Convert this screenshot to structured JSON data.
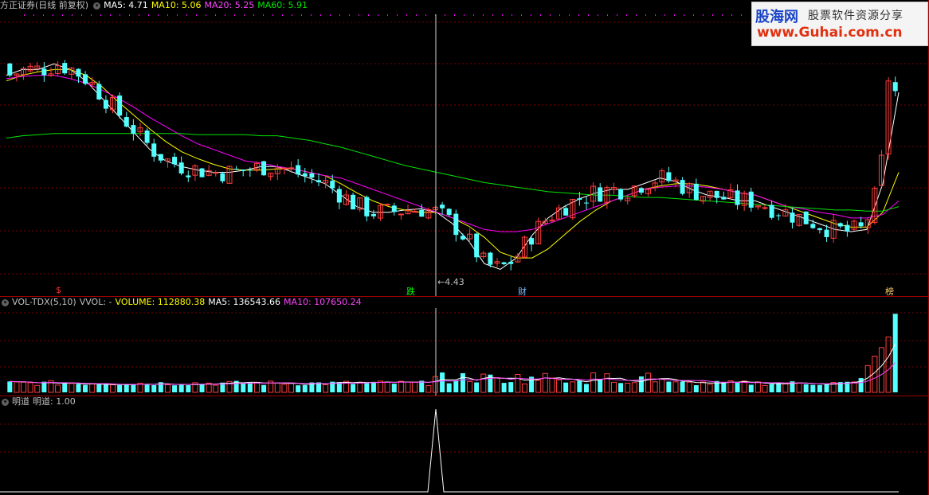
{
  "header": {
    "title": "方正证券(日线 前复权)",
    "ma5": "MA5: 4.71",
    "ma10": "MA10: 5.06",
    "ma20": "MA20: 5.25",
    "ma60": "MA60: 5.91"
  },
  "vol_header": {
    "name": "VOL-TDX(5,10)",
    "vvol": "VVOL: -",
    "volume": "VOLUME: 112880.38",
    "ma5": "MA5: 136543.66",
    "ma10": "MA10: 107650.24"
  },
  "ind_header": {
    "name": "明道",
    "value": "明道: 1.00"
  },
  "watermark": {
    "line1": "股海网",
    "line2": "股票软件资源分享",
    "line3": "www.Guhai.com.cn"
  },
  "markers": {
    "m1": "$",
    "m2": "跌",
    "m3": "财",
    "m4": "榜",
    "low_label": "←4.43"
  },
  "colors": {
    "up": "#ff3c3c",
    "down": "#54ffff",
    "ma5": "#ffffff",
    "ma10": "#ffff00",
    "ma20": "#ff00ff",
    "ma60": "#00e600"
  },
  "chart_data": [
    {
      "type": "candlestick",
      "title": "方正证券(日线 前复权)",
      "ylim": [
        4.3,
        6.6
      ],
      "low_label": 4.43,
      "series": [
        {
          "name": "MA5",
          "values": [
            6.15,
            6.2,
            6.2,
            6.25,
            6.2,
            6.1,
            5.95,
            5.8,
            5.65,
            5.5,
            5.4,
            5.35,
            5.32,
            5.3,
            5.3,
            5.32,
            5.35,
            5.35,
            5.3,
            5.25,
            5.2,
            5.1,
            5.0,
            4.95,
            4.95,
            4.97,
            4.98,
            4.95,
            4.85,
            4.7,
            4.5,
            4.45,
            4.55,
            4.75,
            4.9,
            5.0,
            5.07,
            5.12,
            5.15,
            5.15,
            5.2,
            5.25,
            5.22,
            5.15,
            5.1,
            5.08,
            5.05,
            5.05,
            5.0,
            4.95,
            4.9,
            4.85,
            4.8,
            4.78,
            4.8,
            5.2,
            6.0
          ]
        },
        {
          "name": "MA10",
          "values": [
            6.1,
            6.15,
            6.18,
            6.2,
            6.2,
            6.15,
            6.05,
            5.92,
            5.8,
            5.68,
            5.57,
            5.48,
            5.42,
            5.37,
            5.33,
            5.32,
            5.32,
            5.33,
            5.33,
            5.3,
            5.27,
            5.2,
            5.12,
            5.05,
            5.0,
            4.97,
            4.95,
            4.95,
            4.9,
            4.83,
            4.73,
            4.6,
            4.55,
            4.55,
            4.63,
            4.75,
            4.87,
            4.97,
            5.05,
            5.1,
            5.15,
            5.18,
            5.2,
            5.2,
            5.18,
            5.15,
            5.12,
            5.1,
            5.05,
            5.0,
            4.95,
            4.9,
            4.85,
            4.82,
            4.82,
            4.95,
            5.3
          ]
        },
        {
          "name": "MA20",
          "values": [
            6.12,
            6.14,
            6.15,
            6.15,
            6.12,
            6.08,
            6.02,
            5.95,
            5.87,
            5.78,
            5.7,
            5.62,
            5.55,
            5.5,
            5.45,
            5.4,
            5.38,
            5.35,
            5.33,
            5.3,
            5.27,
            5.25,
            5.2,
            5.15,
            5.1,
            5.05,
            5.0,
            4.95,
            4.9,
            4.85,
            4.8,
            4.78,
            4.78,
            4.8,
            4.85,
            4.9,
            4.95,
            5.0,
            5.05,
            5.1,
            5.15,
            5.17,
            5.18,
            5.18,
            5.17,
            5.15,
            5.12,
            5.1,
            5.05,
            5.0,
            4.98,
            4.95,
            4.93,
            4.9,
            4.9,
            4.93,
            5.05
          ]
        },
        {
          "name": "MA60",
          "values": [
            5.6,
            5.62,
            5.63,
            5.64,
            5.64,
            5.64,
            5.64,
            5.64,
            5.64,
            5.64,
            5.64,
            5.64,
            5.63,
            5.63,
            5.63,
            5.63,
            5.62,
            5.62,
            5.6,
            5.58,
            5.55,
            5.52,
            5.48,
            5.44,
            5.4,
            5.36,
            5.33,
            5.3,
            5.27,
            5.24,
            5.21,
            5.19,
            5.17,
            5.15,
            5.13,
            5.12,
            5.11,
            5.1,
            5.1,
            5.09,
            5.08,
            5.08,
            5.07,
            5.06,
            5.05,
            5.04,
            5.03,
            5.02,
            5.01,
            5.0,
            4.99,
            4.98,
            4.97,
            4.97,
            4.96,
            4.96,
            5.0
          ]
        }
      ]
    },
    {
      "type": "bar",
      "title": "VOL-TDX(5,10)",
      "ylim": [
        0,
        500000
      ],
      "volume": 112880.38,
      "ma5": 136543.66,
      "ma10": 107650.24
    },
    {
      "type": "line",
      "title": "明道",
      "value": 1.0,
      "ylim": [
        0,
        1
      ]
    }
  ]
}
